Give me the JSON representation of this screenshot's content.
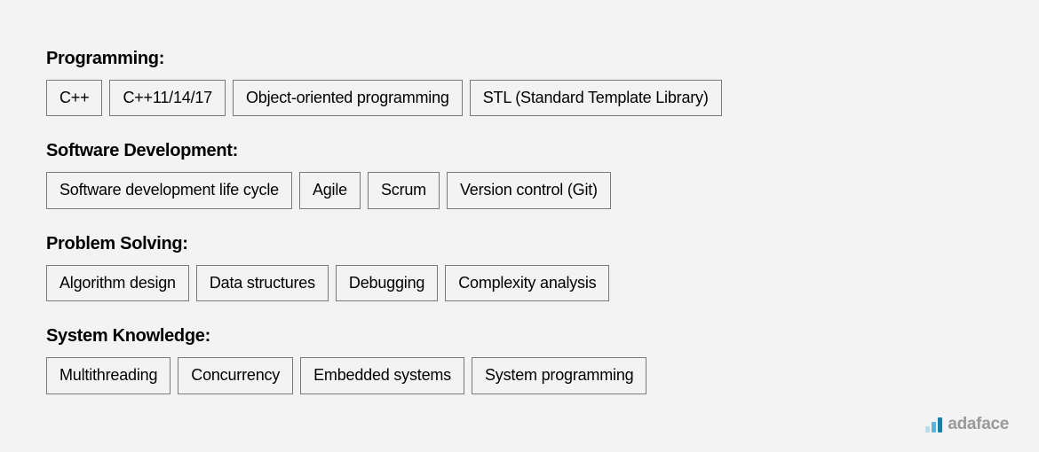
{
  "categories": [
    {
      "title": "Programming:",
      "tags": [
        "C++",
        "C++11/14/17",
        "Object-oriented programming",
        "STL (Standard Template Library)"
      ]
    },
    {
      "title": "Software Development:",
      "tags": [
        "Software development life cycle",
        "Agile",
        "Scrum",
        "Version control (Git)"
      ]
    },
    {
      "title": "Problem Solving:",
      "tags": [
        "Algorithm design",
        "Data structures",
        "Debugging",
        "Complexity analysis"
      ]
    },
    {
      "title": "System Knowledge:",
      "tags": [
        "Multithreading",
        "Concurrency",
        "Embedded systems",
        "System programming"
      ]
    }
  ],
  "footer": {
    "brand": "adaface"
  }
}
